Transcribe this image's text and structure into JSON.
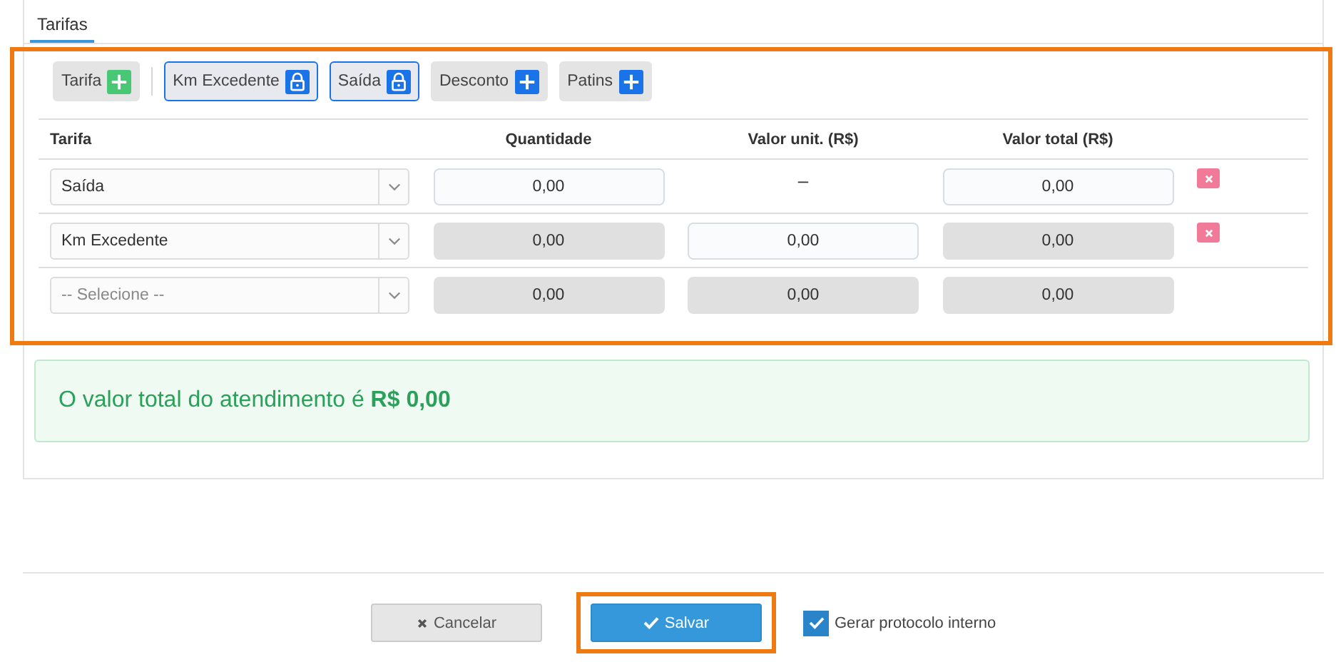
{
  "tabs": [
    {
      "label": "Tarifas",
      "selected": true
    }
  ],
  "highlighted": {
    "tariff_panel": true,
    "save_button": true
  },
  "chips": [
    {
      "label": "Tarifa",
      "kind": "add",
      "color": "#48c774"
    },
    {
      "label": "Km Excedente",
      "kind": "locked",
      "color": "#1a73e8"
    },
    {
      "label": "Saída",
      "kind": "locked",
      "color": "#1a73e8"
    },
    {
      "label": "Desconto",
      "kind": "add",
      "color": "#1a73e8"
    },
    {
      "label": "Patins",
      "kind": "add",
      "color": "#1a73e8"
    }
  ],
  "table": {
    "columns": [
      "Tarifa",
      "Quantidade",
      "Valor unit. (R$)",
      "Valor total (R$)"
    ],
    "rows": [
      {
        "cells": [
          {
            "kind": "select",
            "value": "Saída"
          },
          {
            "kind": "input",
            "value": "0,00"
          },
          {
            "kind": "dash",
            "text": "–"
          },
          {
            "kind": "input",
            "value": "0,00"
          }
        ],
        "removable": true
      },
      {
        "cells": [
          {
            "kind": "select",
            "value": "Km Excedente"
          },
          {
            "kind": "disabled",
            "value": "0,00"
          },
          {
            "kind": "input",
            "value": "0,00"
          },
          {
            "kind": "disabled",
            "value": "0,00"
          }
        ],
        "removable": true
      },
      {
        "cells": [
          {
            "kind": "select",
            "placeholder": "-- Selecione --"
          },
          {
            "kind": "disabled",
            "value": "0,00"
          },
          {
            "kind": "disabled",
            "value": "0,00"
          },
          {
            "kind": "disabled",
            "value": "0,00"
          }
        ],
        "removable": false
      }
    ]
  },
  "total_alert": "O valor total do atendimento é **R$ 0,00**",
  "buttons": {
    "cancel": "Cancelar",
    "save": "Salvar"
  },
  "protocol_checkbox": {
    "label": "Gerar protocolo interno",
    "checked": true
  }
}
